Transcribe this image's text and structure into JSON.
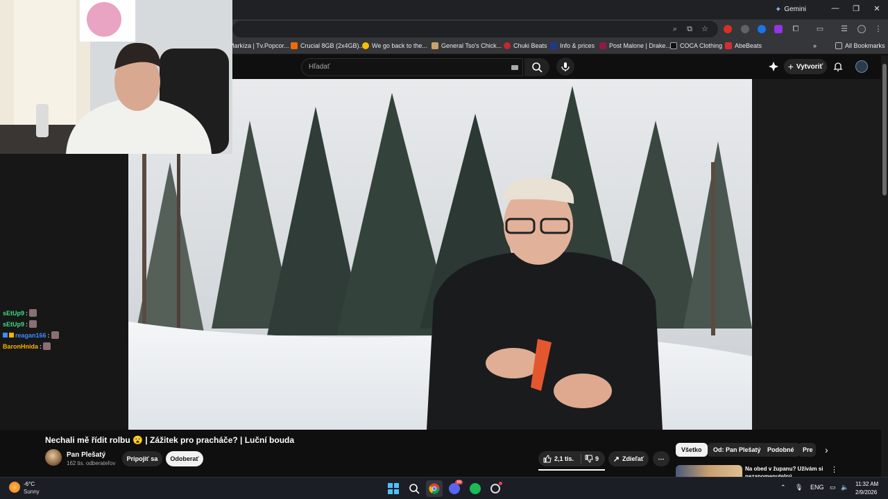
{
  "browser": {
    "gemini_label": "Gemini",
    "bookmarks": [
      {
        "label": "Markíza | Tv.Popcor...",
        "color": "#e53935"
      },
      {
        "label": "Crucial 8GB (2x4GB)...",
        "color": "#ef6c00"
      },
      {
        "label": "We go back to the...",
        "color": "#fbbc05"
      },
      {
        "label": "General Tso's Chick...",
        "color": "#c8a26a"
      },
      {
        "label": "Chuki Beats",
        "color": "#c62828"
      },
      {
        "label": "Info & prices",
        "color": "#1a3a8a"
      },
      {
        "label": "Post Malone | Drake...",
        "color": "#8e1a4a"
      },
      {
        "label": "COCA Clothing",
        "color": "#111111"
      },
      {
        "label": "AbeBeats",
        "color": "#d32f2f"
      }
    ],
    "all_bookmarks": "All Bookmarks"
  },
  "youtube": {
    "search_placeholder": "Hľadať",
    "create_label": "Vytvoriť"
  },
  "video": {
    "title": "Nechali mě řídit rolbu 😮 | Zážitek pro pracháče? | Luční bouda",
    "channel": "Pan Plešatý",
    "subscribers": "162 tis. odberateľov",
    "join_label": "Pripojiť sa",
    "subscribe_label": "Odoberať",
    "likes": "2,1 tis.",
    "dislikes": "9",
    "share_label": "Zdieľať",
    "more_label": "⋯"
  },
  "chips": [
    "Všetko",
    "Od: Pan Plešatý",
    "Podobné",
    "Pre"
  ],
  "recommendation": {
    "title": "Na obed v županu? Užívám si nezapomenutelný"
  },
  "chat": [
    {
      "user": "sEtUp9",
      "color": "#3ddc84"
    },
    {
      "user": "sEtUp9",
      "color": "#3ddc84"
    },
    {
      "user": "reagan166",
      "color": "#3a8dff"
    },
    {
      "user": "BaronHnida",
      "color": "#ffb000"
    }
  ],
  "taskbar": {
    "temperature": "-6°C",
    "condition": "Sunny",
    "language": "ENG",
    "time": "11:32 AM",
    "date": "2/9/2026",
    "discord_badge": "99"
  }
}
